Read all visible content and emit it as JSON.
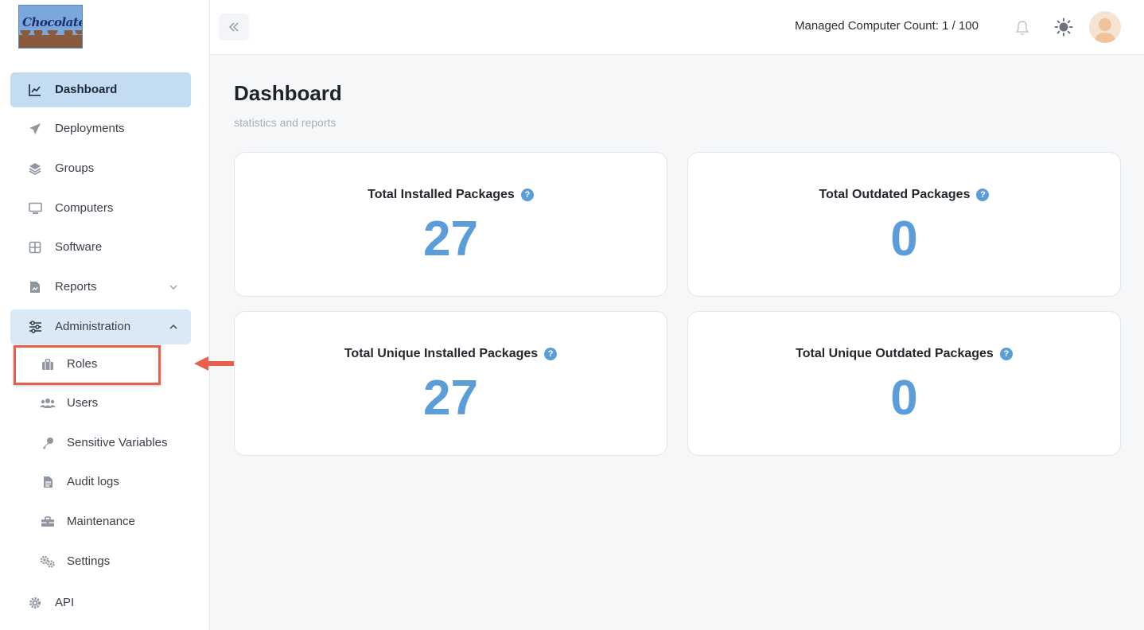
{
  "logo": {
    "text": "Chocolatey"
  },
  "sidebar": {
    "items": [
      {
        "label": "Dashboard",
        "icon": "chart-line-icon"
      },
      {
        "label": "Deployments",
        "icon": "paper-plane-icon"
      },
      {
        "label": "Groups",
        "icon": "layers-icon"
      },
      {
        "label": "Computers",
        "icon": "desktop-icon"
      },
      {
        "label": "Software",
        "icon": "grid-icon"
      },
      {
        "label": "Reports",
        "icon": "report-icon"
      },
      {
        "label": "Administration",
        "icon": "sliders-icon"
      }
    ],
    "admin_items": [
      {
        "label": "Roles",
        "icon": "briefcase-icon"
      },
      {
        "label": "Users",
        "icon": "users-icon"
      },
      {
        "label": "Sensitive Variables",
        "icon": "key-icon"
      },
      {
        "label": "Audit logs",
        "icon": "document-icon"
      },
      {
        "label": "Maintenance",
        "icon": "toolbox-icon"
      },
      {
        "label": "Settings",
        "icon": "gears-icon"
      }
    ],
    "api": {
      "label": "API",
      "icon": "gear-icon"
    }
  },
  "header": {
    "managed_count": "Managed Computer Count: 1 / 100"
  },
  "main": {
    "title": "Dashboard",
    "subtitle": "statistics and reports",
    "cards": [
      {
        "title": "Total Installed Packages",
        "value": "27"
      },
      {
        "title": "Total Outdated Packages",
        "value": "0"
      },
      {
        "title": "Total Unique Installed Packages",
        "value": "27"
      },
      {
        "title": "Total Unique Outdated Packages",
        "value": "0"
      }
    ],
    "help_glyph": "?"
  },
  "colors": {
    "accent": "#5b9dd9",
    "active_nav": "#c4dcf2",
    "annotation": "#e8604c"
  }
}
